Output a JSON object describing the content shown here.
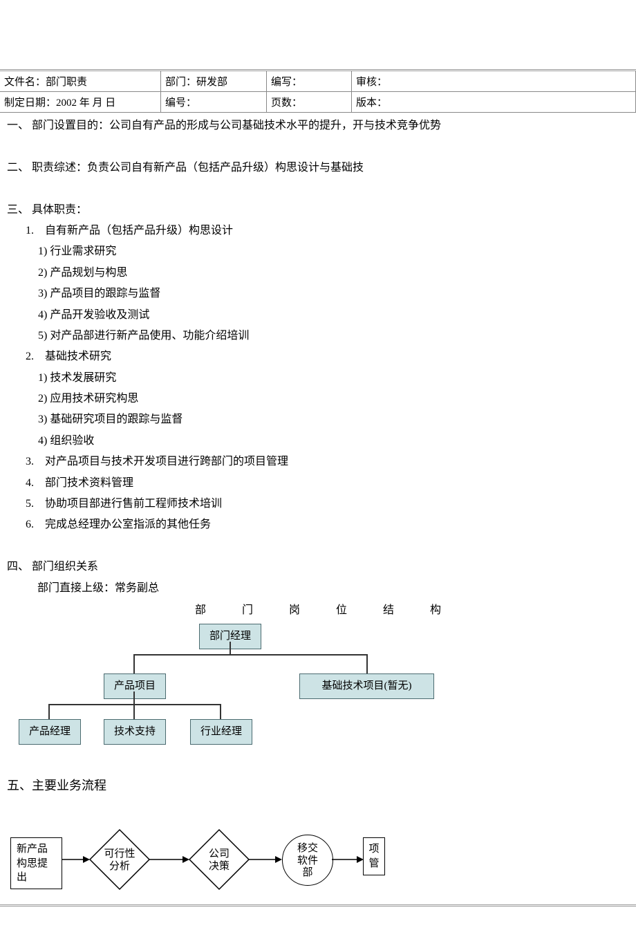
{
  "header": {
    "r1c1": "文件名：部门职责",
    "r1c2": "部门：研发部",
    "r1c3": "编写：",
    "r1c4": "审核：",
    "r2c1": "制定日期：2002 年 月 日",
    "r2c2": "编号：",
    "r2c3": "页数：",
    "r2c4": "版本："
  },
  "s1": "一、 部门设置目的：公司自有产品的形成与公司基础技术水平的提升，开与技术竞争优势",
  "s2": "二、 职责综述：负责公司自有新产品（包括产品升级）构思设计与基础技",
  "s3": {
    "title": "三、 具体职责：",
    "i1": "1. 自有新产品（包括产品升级）构思设计",
    "i1a": "1) 行业需求研究",
    "i1b": "2) 产品规划与构思",
    "i1c": "3) 产品项目的跟踪与监督",
    "i1d": "4) 产品开发验收及测试",
    "i1e": "5) 对产品部进行新产品使用、功能介绍培训",
    "i2": "2. 基础技术研究",
    "i2a": "1) 技术发展研究",
    "i2b": "2) 应用技术研究构思",
    "i2c": "3) 基础研究项目的跟踪与监督",
    "i2d": "4) 组织验收",
    "i3": "3. 对产品项目与技术开发项目进行跨部门的项目管理",
    "i4": "4. 部门技术资料管理",
    "i5": "5. 协助项目部进行售前工程师技术培训",
    "i6": "6. 完成总经理办公室指派的其他任务"
  },
  "s4": {
    "title": "四、 部门组织关系",
    "sub": "部门直接上级：常务副总",
    "chartTitle": [
      "部",
      "门",
      "岗",
      "位",
      "结",
      "构"
    ]
  },
  "org": {
    "n1": "部门经理",
    "n2": "产品项目",
    "n3": "基础技术项目(暂无)",
    "n4": "产品经理",
    "n5": "技术支持",
    "n6": "行业经理"
  },
  "s5": "五、主要业务流程",
  "flow": {
    "b1a": "新产品",
    "b1b": "构思提",
    "b1c": "出",
    "d1a": "可行性",
    "d1b": "分析",
    "d2a": "公司",
    "d2b": "决策",
    "c1a": "移交",
    "c1b": "软件",
    "c1c": "部",
    "b2a": "项",
    "b2b": "管"
  }
}
